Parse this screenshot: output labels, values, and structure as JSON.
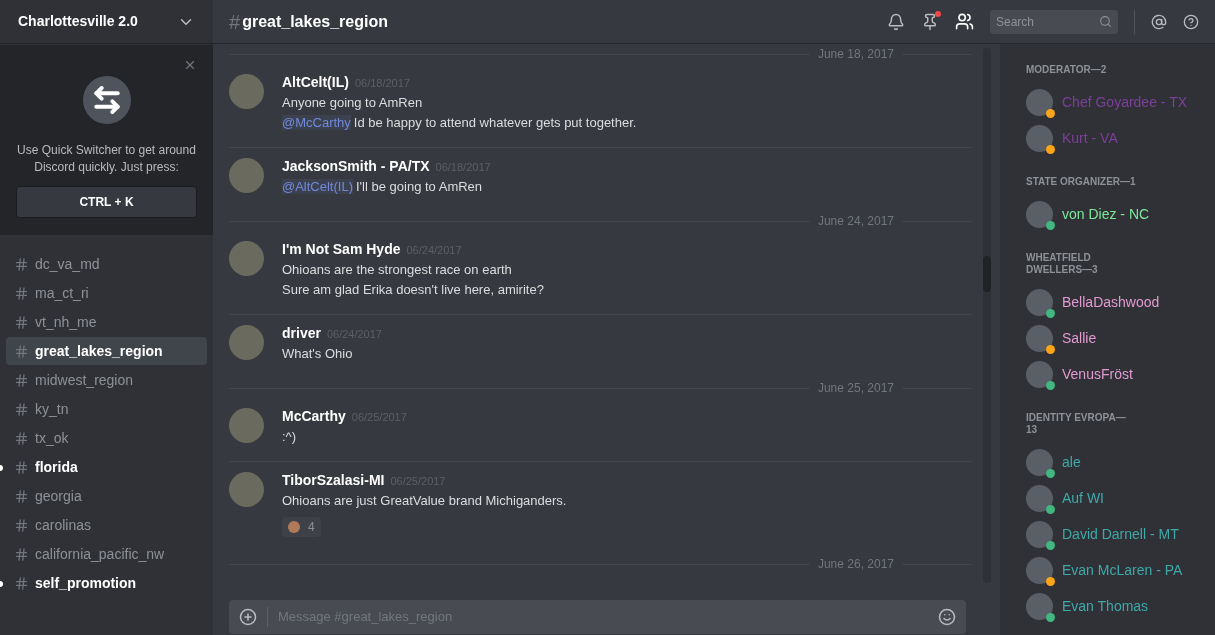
{
  "server": {
    "name": "Charlottesville 2.0"
  },
  "quick_switcher": {
    "text": "Use Quick Switcher to get around Discord quickly. Just press:",
    "shortcut": "CTRL + K"
  },
  "channels": [
    {
      "name": "dc_va_md",
      "selected": false,
      "unread": false
    },
    {
      "name": "ma_ct_ri",
      "selected": false,
      "unread": false
    },
    {
      "name": "vt_nh_me",
      "selected": false,
      "unread": false
    },
    {
      "name": "great_lakes_region",
      "selected": true,
      "unread": false
    },
    {
      "name": "midwest_region",
      "selected": false,
      "unread": false
    },
    {
      "name": "ky_tn",
      "selected": false,
      "unread": false
    },
    {
      "name": "tx_ok",
      "selected": false,
      "unread": false
    },
    {
      "name": "florida",
      "selected": false,
      "unread": true
    },
    {
      "name": "georgia",
      "selected": false,
      "unread": false
    },
    {
      "name": "carolinas",
      "selected": false,
      "unread": false
    },
    {
      "name": "california_pacific_nw",
      "selected": false,
      "unread": false
    },
    {
      "name": "self_promotion",
      "selected": false,
      "unread": true
    }
  ],
  "header": {
    "hash": "#",
    "channel": "great_lakes_region",
    "search_placeholder": "Search"
  },
  "chat": [
    {
      "kind": "date",
      "text": "June 18, 2017"
    },
    {
      "kind": "message",
      "author": "AltCelt(IL)",
      "time": "06/18/2017",
      "lines": [
        {
          "text": "Anyone going to AmRen"
        },
        {
          "mention": "@McCarthy",
          "text": "Id be happy to attend whatever gets put together."
        }
      ]
    },
    {
      "kind": "message",
      "author": "JacksonSmith - PA/TX",
      "time": "06/18/2017",
      "lines": [
        {
          "mention": "@AltCelt(IL)",
          "text": "I'll be going to AmRen"
        }
      ]
    },
    {
      "kind": "date",
      "text": "June 24, 2017"
    },
    {
      "kind": "message",
      "author": "I'm Not Sam Hyde",
      "time": "06/24/2017",
      "lines": [
        {
          "text": "Ohioans are the strongest race on earth"
        },
        {
          "text": "Sure am glad Erika doesn't live here, amirite?"
        }
      ]
    },
    {
      "kind": "message",
      "author": "driver",
      "time": "06/24/2017",
      "lines": [
        {
          "text": "What's Ohio"
        }
      ]
    },
    {
      "kind": "date",
      "text": "June 25, 2017"
    },
    {
      "kind": "message",
      "author": "McCarthy",
      "time": "06/25/2017",
      "lines": [
        {
          "text": ":^)"
        }
      ]
    },
    {
      "kind": "message",
      "author": "TiborSzalasi-MI",
      "time": "06/25/2017",
      "lines": [
        {
          "text": "Ohioans are just GreatValue brand Michiganders."
        }
      ],
      "reaction": {
        "count": "4"
      }
    },
    {
      "kind": "date",
      "text": "June 26, 2017"
    }
  ],
  "composer": {
    "placeholder": "Message #great_lakes_region"
  },
  "member_groups": [
    {
      "title": "MODERATOR—2",
      "color": "#7c3f9a",
      "members": [
        {
          "name": "Chef Goyardee - TX",
          "color": "#faa61a"
        },
        {
          "name": "Kurt - VA",
          "color": "#faa61a"
        }
      ]
    },
    {
      "title": "STATE ORGANIZER—1",
      "color": "#7ee89a",
      "members": [
        {
          "name": "von Diez - NC",
          "color": "#43b581"
        }
      ]
    },
    {
      "title": "WHEATFIELD DWELLERS—3",
      "color": "#e39ad0",
      "members": [
        {
          "name": "BellaDashwood",
          "color": "#43b581"
        },
        {
          "name": "Sallie",
          "color": "#faa61a"
        },
        {
          "name": "VenusFröst",
          "color": "#43b581"
        }
      ]
    },
    {
      "title": "IDENTITY EVROPA—13",
      "color": "#3fa8a8",
      "members": [
        {
          "name": "ale",
          "color": "#43b581"
        },
        {
          "name": "Auf WI",
          "color": "#43b581"
        },
        {
          "name": "David Darnell - MT",
          "color": "#43b581"
        },
        {
          "name": "Evan McLaren - PA",
          "color": "#faa61a"
        },
        {
          "name": "Evan Thomas",
          "color": "#43b581"
        }
      ]
    }
  ]
}
